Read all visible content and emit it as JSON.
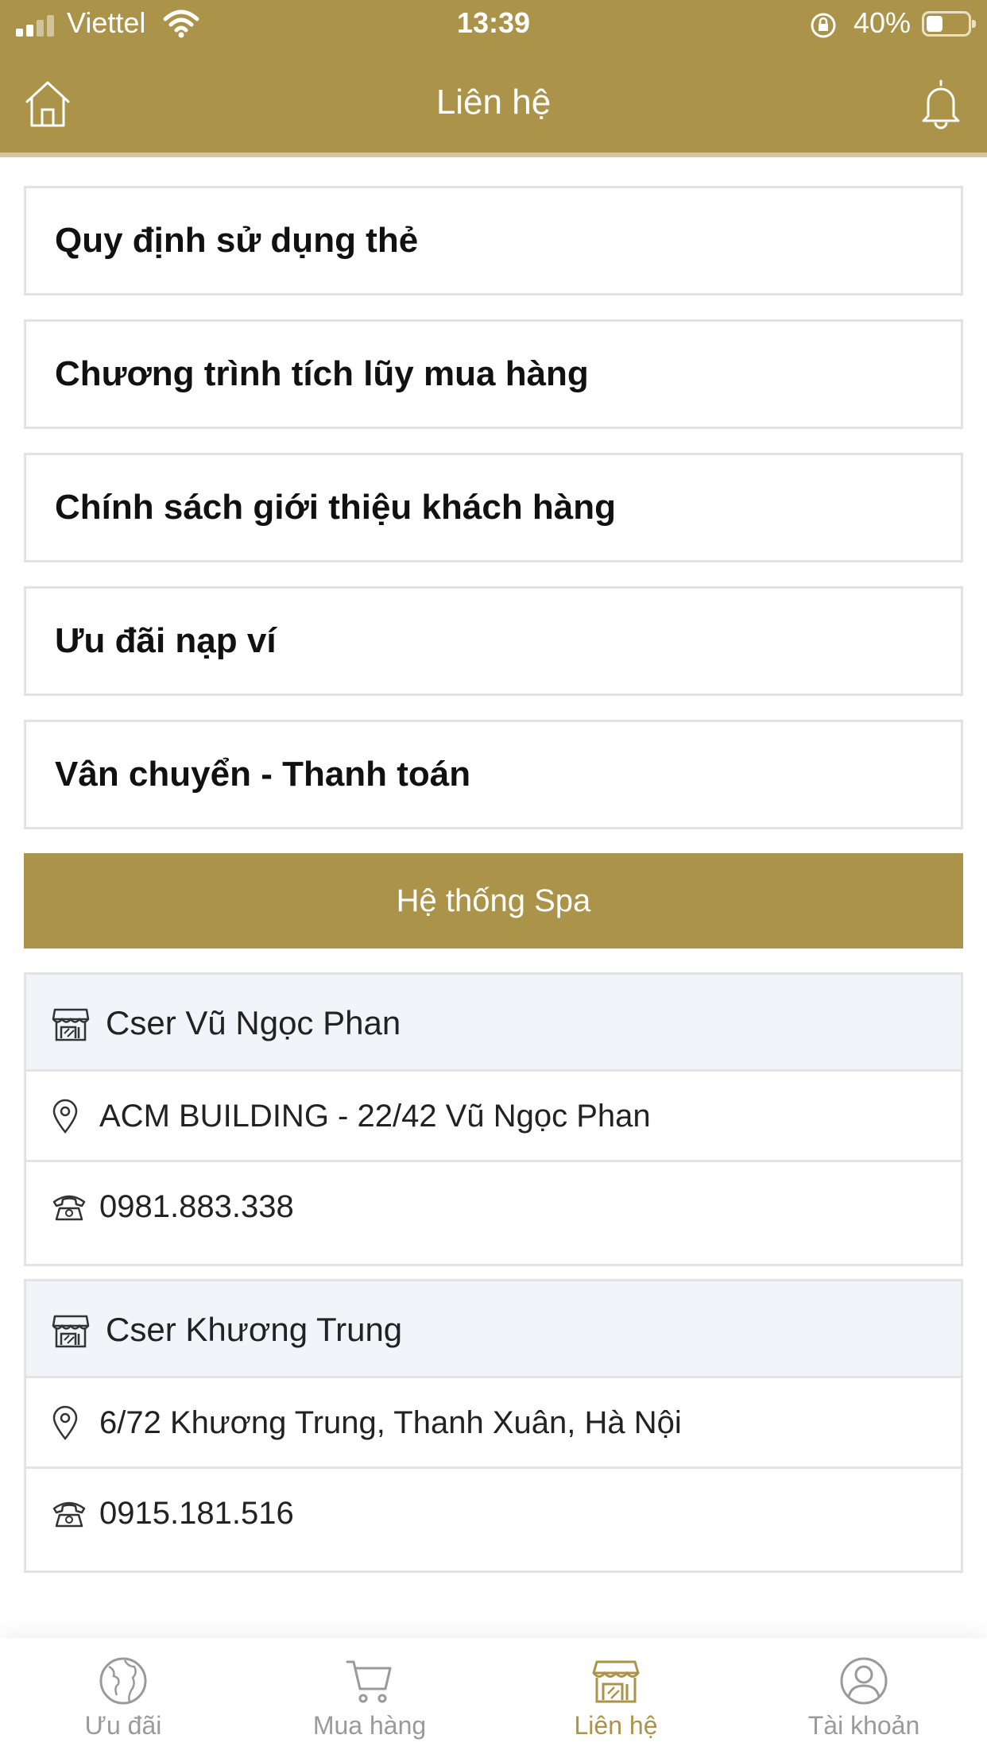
{
  "status_bar": {
    "carrier": "Viettel",
    "time": "13:39",
    "battery": "40%"
  },
  "header": {
    "title": "Liên hệ",
    "home_icon": "home-icon",
    "bell_icon": "bell-icon"
  },
  "colors": {
    "brand": "#ab9349",
    "card_header_bg": "#f1f5f9",
    "border": "#e3e3e3"
  },
  "menu": [
    {
      "label": "Quy định sử dụng thẻ"
    },
    {
      "label": "Chương trình tích lũy mua hàng"
    },
    {
      "label": "Chính sách giới thiệu khách hàng"
    },
    {
      "label": "Ưu đãi nạp ví"
    },
    {
      "label": "Vân chuyển - Thanh toán"
    }
  ],
  "spa_section": {
    "title": "Hệ thống Spa",
    "locations": [
      {
        "name": "Cser Vũ Ngọc Phan",
        "address": "ACM BUILDING - 22/42 Vũ Ngọc Phan",
        "phone": "0981.883.338"
      },
      {
        "name": "Cser Khương Trung",
        "address": "6/72 Khương Trung, Thanh Xuân, Hà Nội",
        "phone": "0915.181.516"
      }
    ]
  },
  "bottom_nav": {
    "items": [
      {
        "label": "Ưu đãi",
        "icon": "globe-icon",
        "active": false
      },
      {
        "label": "Mua hàng",
        "icon": "cart-icon",
        "active": false
      },
      {
        "label": "Liên hệ",
        "icon": "store-icon",
        "active": true
      },
      {
        "label": "Tài khoản",
        "icon": "user-icon",
        "active": false
      }
    ]
  }
}
